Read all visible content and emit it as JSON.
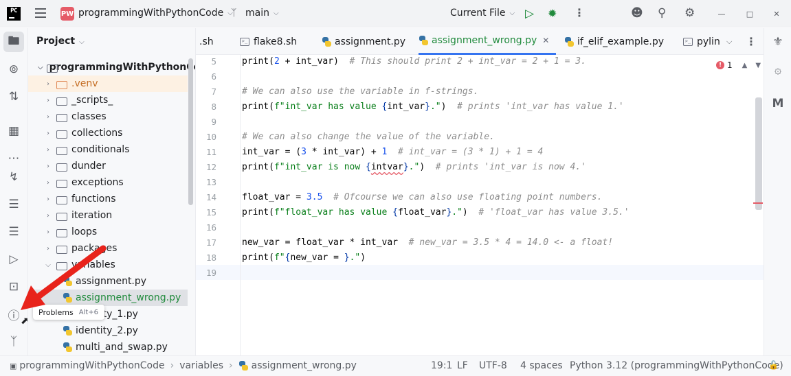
{
  "titlebar": {
    "logo": "PC",
    "project_badge": "PW",
    "project_name": "programmingWithPythonCode",
    "branch": "main",
    "run_config": "Current File"
  },
  "left_toolbar": [
    "folder-icon",
    "commit-icon",
    "pull-requests-icon",
    "structure-icon",
    "more-icon",
    "python-console-icon",
    "todo-icon",
    "layers-icon",
    "run-icon",
    "terminal-icon",
    "problems-icon",
    "git-icon"
  ],
  "project_panel": {
    "title": "Project",
    "root": "programmingWithPythonCode",
    "items": [
      {
        "label": ".venv",
        "type": "folder",
        "style": "excluded"
      },
      {
        "label": "_scripts_",
        "type": "folder"
      },
      {
        "label": "classes",
        "type": "folder"
      },
      {
        "label": "collections",
        "type": "folder"
      },
      {
        "label": "conditionals",
        "type": "folder"
      },
      {
        "label": "dunder",
        "type": "folder"
      },
      {
        "label": "exceptions",
        "type": "folder"
      },
      {
        "label": "functions",
        "type": "folder"
      },
      {
        "label": "iteration",
        "type": "folder"
      },
      {
        "label": "loops",
        "type": "folder"
      },
      {
        "label": "packages",
        "type": "folder"
      },
      {
        "label": "variables",
        "type": "folder",
        "expanded": true
      },
      {
        "label": "assignment.py",
        "type": "file"
      },
      {
        "label": "assignment_wrong.py",
        "type": "file",
        "selected": true
      },
      {
        "label": "identity_1.py",
        "type": "file"
      },
      {
        "label": "identity_2.py",
        "type": "file"
      },
      {
        "label": "multi_and_swap.py",
        "type": "file"
      }
    ]
  },
  "tabs": [
    {
      "label": ".sh",
      "icon": "none"
    },
    {
      "label": "flake8.sh",
      "icon": "shell-icon"
    },
    {
      "label": "assignment.py",
      "icon": "python-icon"
    },
    {
      "label": "assignment_wrong.py",
      "icon": "python-icon",
      "active": true
    },
    {
      "label": "if_elif_example.py",
      "icon": "python-icon"
    },
    {
      "label": "pylin",
      "icon": "shell-icon"
    }
  ],
  "editor": {
    "error_count": "1",
    "lines": [
      {
        "n": "5",
        "html": "print(<span class='num'>2</span> + int_var)  <span class='cm'># This should print 2 + int_var = 2 + 1 = 3.</span>"
      },
      {
        "n": "6",
        "html": ""
      },
      {
        "n": "7",
        "html": "<span class='cm'># We can also use the variable in f-strings.</span>"
      },
      {
        "n": "8",
        "html": "print(<span class='str'>f\"int_var has value </span><span class='brc'>{</span>int_var<span class='brc'>}</span><span class='str'>.\"</span>)  <span class='cm'># prints 'int_var has value 1.'</span>"
      },
      {
        "n": "9",
        "html": ""
      },
      {
        "n": "10",
        "html": "<span class='cm'># We can also change the value of the variable.</span>"
      },
      {
        "n": "11",
        "html": "int_var = (<span class='num'>3</span> * int_var) + <span class='num'>1</span>  <span class='cm'># int_var = (3 * 1) + 1 = 4</span>"
      },
      {
        "n": "12",
        "html": "print(<span class='str'>f\"int_var is now </span><span class='brc'>{</span><span class='squig'>intvar</span><span class='brc'>}</span><span class='str'>.\"</span>)  <span class='cm'># prints 'int_var is now 4.'</span>"
      },
      {
        "n": "13",
        "html": ""
      },
      {
        "n": "14",
        "html": "float_var = <span class='num'>3.5</span>  <span class='cm'># Ofcourse we can also use floating point numbers.</span>"
      },
      {
        "n": "15",
        "html": "print(<span class='str'>f\"float_var has value </span><span class='brc'>{</span>float_var<span class='brc'>}</span><span class='str'>.\"</span>)  <span class='cm'># 'float_var has value 3.5.'</span>"
      },
      {
        "n": "16",
        "html": ""
      },
      {
        "n": "17",
        "html": "new_var = float_var * int_var  <span class='cm'># new_var = 3.5 * 4 = 14.0 &lt;- a float!</span>"
      },
      {
        "n": "18",
        "html": "print(<span class='str'>f\"</span><span class='brc'>{</span>new_var = <span class='brc'>}</span><span class='str'>.\"</span>)"
      },
      {
        "n": "19",
        "html": ""
      }
    ]
  },
  "tooltip": {
    "label": "Problems",
    "shortcut": "Alt+6"
  },
  "statusbar": {
    "crumbs": [
      "programmingWithPythonCode",
      "variables",
      "assignment_wrong.py"
    ],
    "position": "19:1",
    "line_sep": "LF",
    "encoding": "UTF-8",
    "indent": "4 spaces",
    "interpreter": "Python 3.12 (programmingWithPythonCode)"
  },
  "colors": {
    "accent": "#3574f0",
    "annotation_arrow": "#e8231b",
    "error": "#e55b67"
  }
}
